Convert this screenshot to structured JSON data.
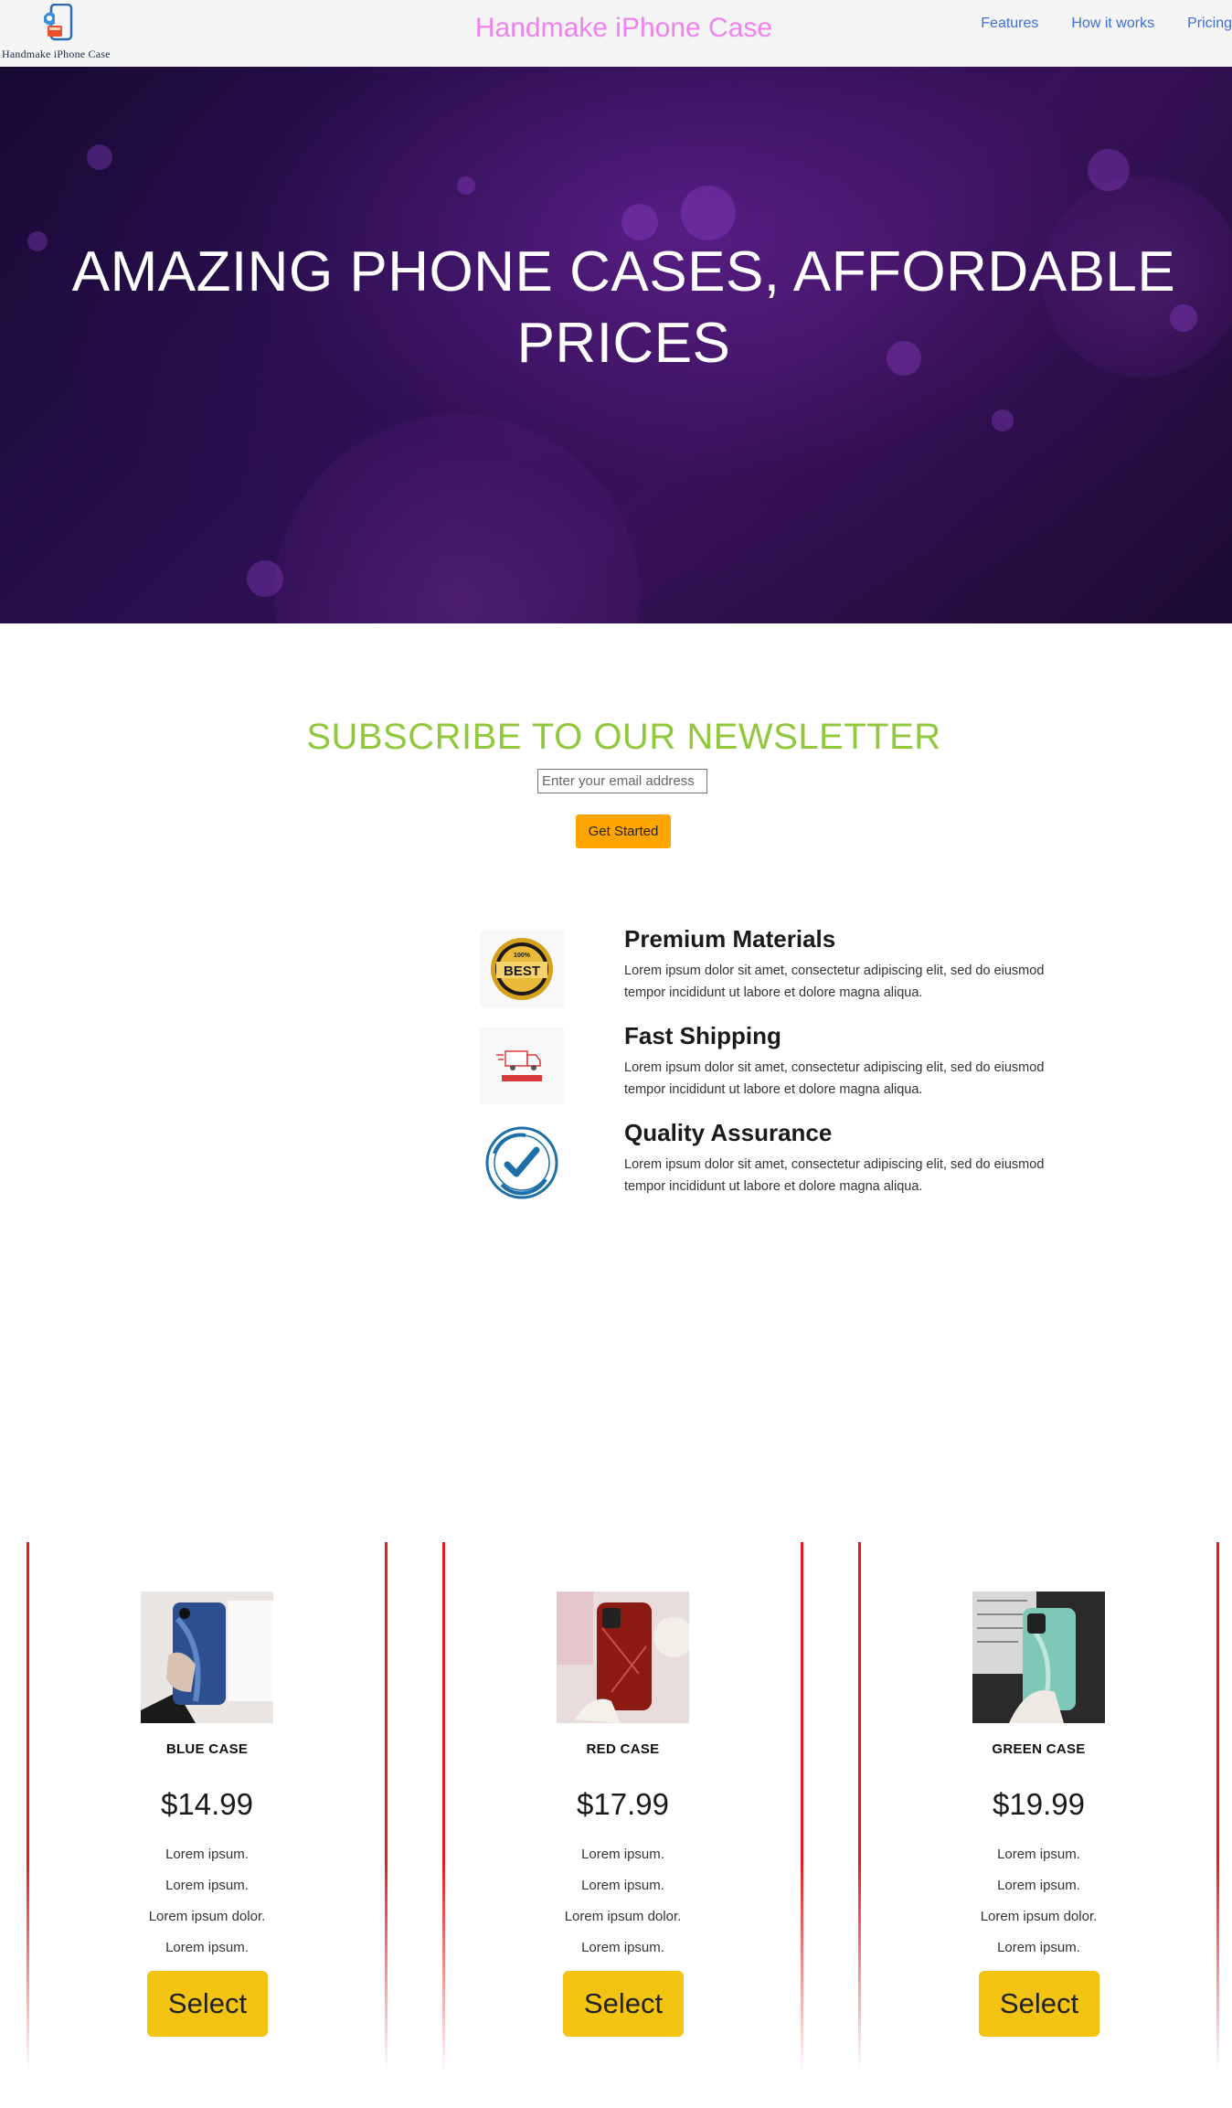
{
  "header": {
    "logo_text": "Handmake iPhone Case",
    "site_title": "Handmake iPhone Case",
    "nav": [
      {
        "label": "Features"
      },
      {
        "label": "How it works"
      },
      {
        "label": "Pricing"
      }
    ]
  },
  "hero": {
    "title_line1": "AMAZING PHONE CASES, AFFORDABLE",
    "title_line2": "PRICES"
  },
  "newsletter": {
    "title": "SUBSCRIBE TO OUR NEWSLETTER",
    "email_placeholder": "Enter your email address",
    "button_label": "Get Started"
  },
  "features": [
    {
      "icon": "best-quality-badge-icon",
      "title": "Premium Materials",
      "description": "Lorem ipsum dolor sit amet, consectetur adipiscing elit, sed do eiusmod tempor incididunt ut labore et dolore magna aliqua."
    },
    {
      "icon": "fast-shipping-truck-icon",
      "title": "Fast Shipping",
      "description": "Lorem ipsum dolor sit amet, consectetur adipiscing elit, sed do eiusmod tempor incididunt ut labore et dolore magna aliqua."
    },
    {
      "icon": "quality-assurance-stamp-icon",
      "title": "Quality Assurance",
      "description": "Lorem ipsum dolor sit amet, consectetur adipiscing elit, sed do eiusmod tempor incididunt ut labore et dolore magna aliqua."
    }
  ],
  "pricing": [
    {
      "name": "BLUE CASE",
      "price": "$14.99",
      "features": [
        "Lorem ipsum.",
        "Lorem ipsum.",
        "Lorem ipsum dolor.",
        "Lorem ipsum."
      ],
      "button_label": "Select",
      "accent_color": "#2d4f8f"
    },
    {
      "name": "RED CASE",
      "price": "$17.99",
      "features": [
        "Lorem ipsum.",
        "Lorem ipsum.",
        "Lorem ipsum dolor.",
        "Lorem ipsum."
      ],
      "button_label": "Select",
      "accent_color": "#8b1a12"
    },
    {
      "name": "GREEN CASE",
      "price": "$19.99",
      "features": [
        "Lorem ipsum.",
        "Lorem ipsum.",
        "Lorem ipsum dolor.",
        "Lorem ipsum."
      ],
      "button_label": "Select",
      "accent_color": "#7fc8b8"
    }
  ],
  "colors": {
    "site_title": "#ee82ee",
    "nav_link": "#3b6fd9",
    "newsletter_title": "#92c83e",
    "get_started_button": "#ffa500",
    "select_button": "#f2c311",
    "card_border": "#e31b1b"
  }
}
